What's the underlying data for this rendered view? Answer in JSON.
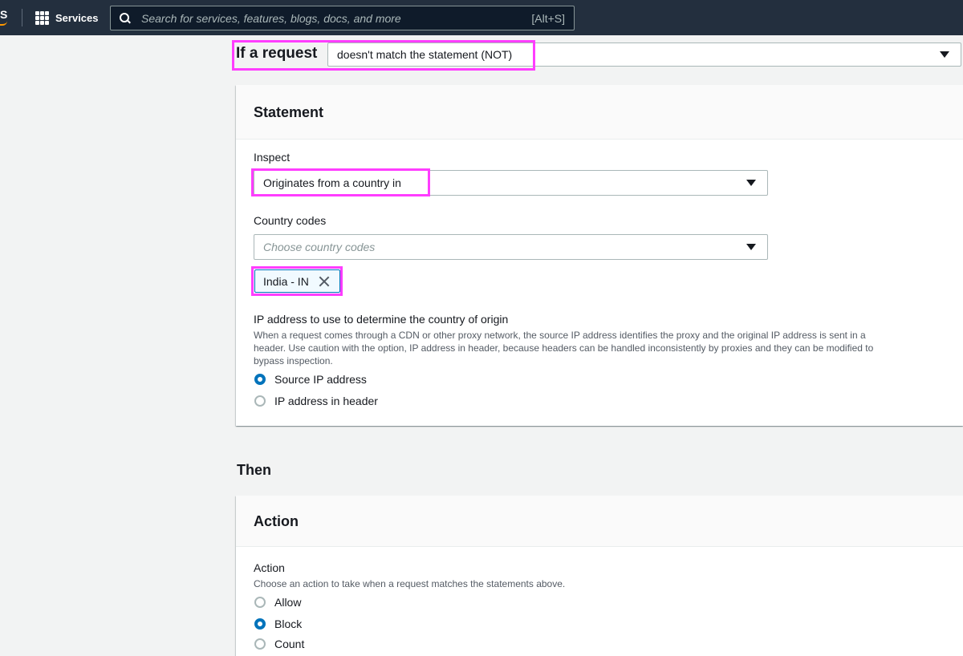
{
  "topnav": {
    "logo_fragment": "S",
    "services_label": "Services",
    "search_placeholder": "Search for services, features, blogs, docs, and more",
    "search_shortcut": "[Alt+S]"
  },
  "rule": {
    "if_label": "If a request",
    "match_value": "doesn't match the statement (NOT)"
  },
  "statement": {
    "title": "Statement",
    "inspect_label": "Inspect",
    "inspect_value": "Originates from a country in",
    "country_codes_label": "Country codes",
    "country_codes_placeholder": "Choose country codes",
    "selected_token": "India - IN",
    "ip_label": "IP address to use to determine the country of origin",
    "ip_desc_1": "When a request comes through a CDN or other proxy network, the source IP address identifies the proxy and the original IP address is sent in a",
    "ip_desc_2": "header. Use caution with the option, IP address in header, because headers can be handled inconsistently by proxies and they can be modified to",
    "ip_desc_3": "bypass inspection.",
    "ip_options": [
      "Source IP address",
      "IP address in header"
    ],
    "ip_selected": "Source IP address"
  },
  "then_label": "Then",
  "action": {
    "title": "Action",
    "label": "Action",
    "description": "Choose an action to take when a request matches the statements above.",
    "options": [
      "Allow",
      "Block",
      "Count"
    ],
    "selected": "Block"
  },
  "colors": {
    "nav_bg": "#232f3e",
    "accent_blue": "#0073bb",
    "highlight_magenta": "#ff3dff"
  }
}
